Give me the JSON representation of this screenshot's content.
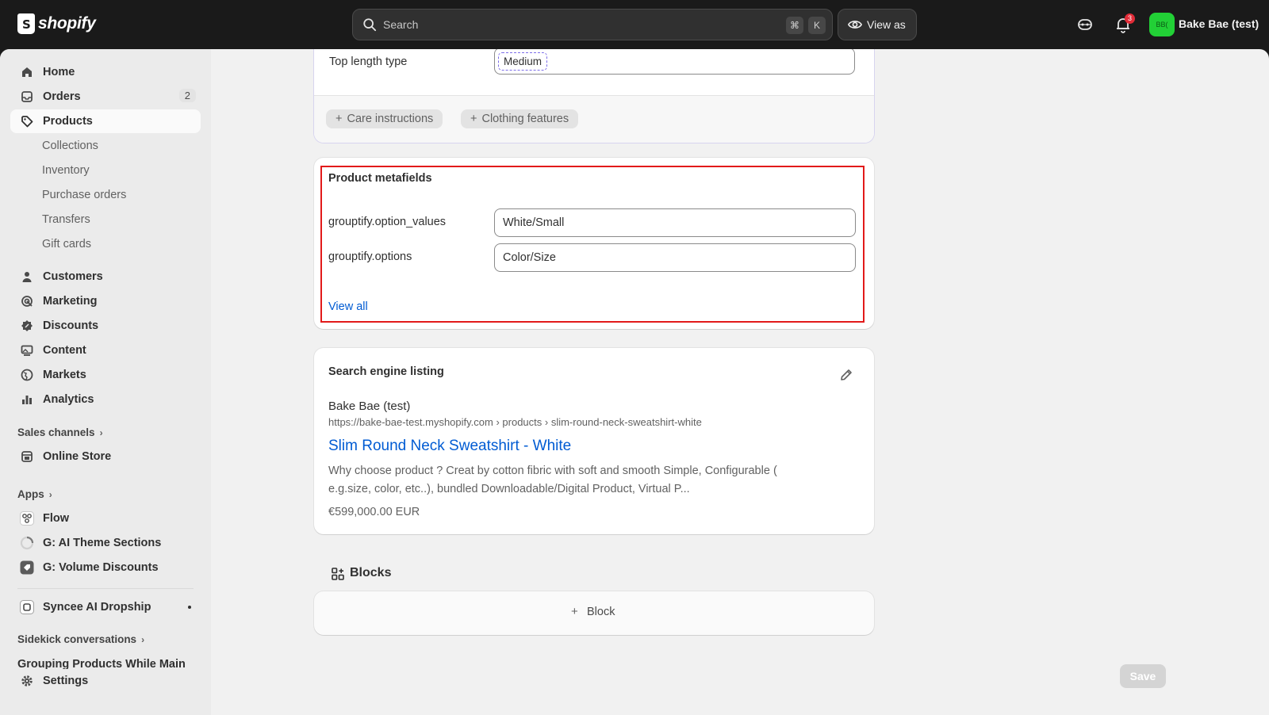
{
  "topbar": {
    "brand": "shopify",
    "search_placeholder": "Search",
    "kbd_cmd": "⌘",
    "kbd_k": "K",
    "view_as": "View as",
    "notification_count": "3",
    "avatar_initials": "BB(",
    "store_name": "Bake Bae (test)"
  },
  "sidebar": {
    "home": "Home",
    "orders": "Orders",
    "orders_count": "2",
    "products": "Products",
    "collections": "Collections",
    "inventory": "Inventory",
    "purchase_orders": "Purchase orders",
    "transfers": "Transfers",
    "gift_cards": "Gift cards",
    "customers": "Customers",
    "marketing": "Marketing",
    "discounts": "Discounts",
    "content": "Content",
    "markets": "Markets",
    "analytics": "Analytics",
    "sales_channels": "Sales channels",
    "online_store": "Online Store",
    "apps": "Apps",
    "flow": "Flow",
    "ai_theme_sections": "G: AI Theme Sections",
    "volume_discounts": "G: Volume Discounts",
    "syncee": "Syncee AI Dropship",
    "sidekick": "Sidekick conversations",
    "sidekick_item": "Grouping Products While Main",
    "settings": "Settings"
  },
  "category_card": {
    "top_length_label": "Top length type",
    "top_length_value": "Medium",
    "care_button": "Care instructions",
    "features_button": "Clothing features"
  },
  "metafields": {
    "title": "Product metafields",
    "rows": [
      {
        "key": "grouptify.option_values",
        "value": "White/Small"
      },
      {
        "key": "grouptify.options",
        "value": "Color/Size"
      }
    ],
    "view_all": "View all"
  },
  "seo": {
    "title": "Search engine listing",
    "store": "Bake Bae (test)",
    "url": "https://bake-bae-test.myshopify.com › products › slim-round-neck-sweatshirt-white",
    "page_title": "Slim Round Neck Sweatshirt - White",
    "description_line1": "Why choose product ? Creat by cotton fibric with soft and smooth Simple, Configurable (",
    "description_line2": "e.g.size, color, etc..), bundled Downloadable/Digital Product, Virtual P...",
    "price": "€599,000.00 EUR"
  },
  "blocks": {
    "title": "Blocks",
    "add_block": "Block"
  },
  "footer": {
    "save": "Save"
  },
  "colors": {
    "highlight": "#e21a1a",
    "link": "#005bd3",
    "avatar": "#22d036",
    "badge": "#e22c38"
  }
}
